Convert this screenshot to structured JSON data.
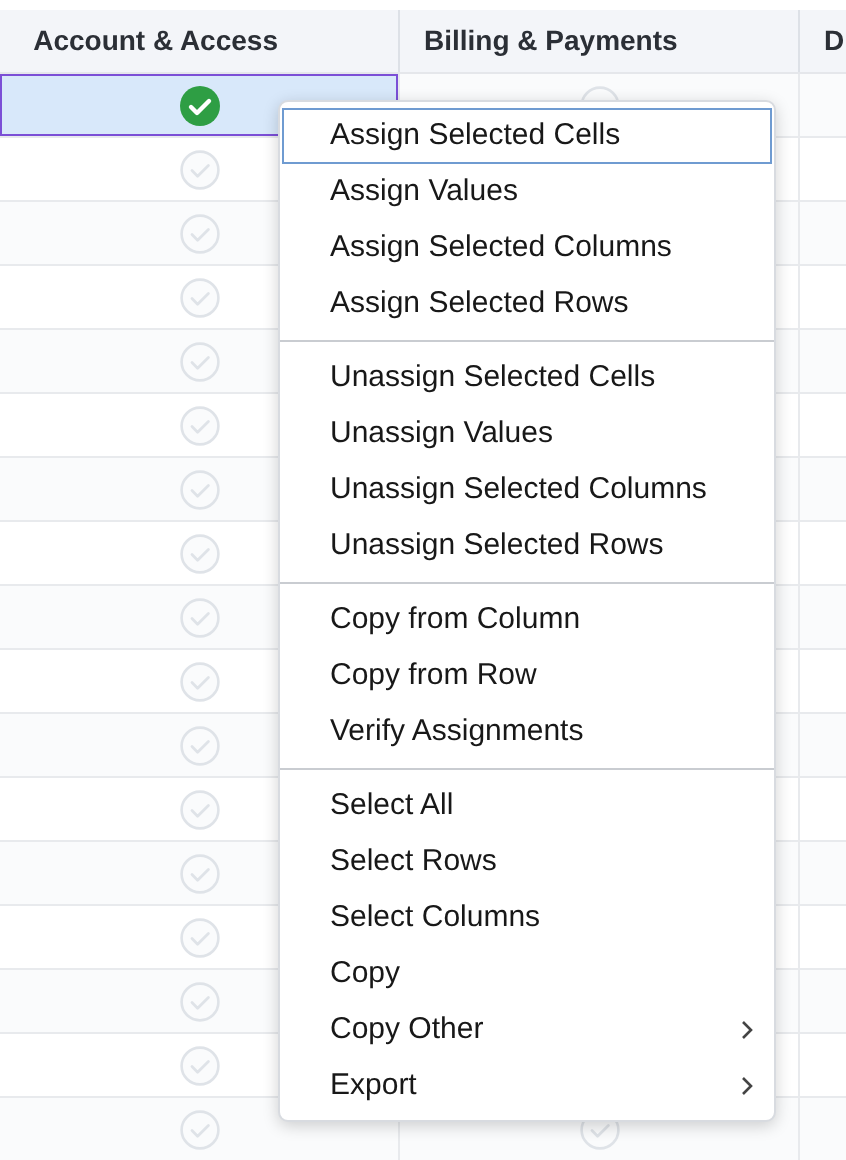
{
  "table": {
    "columns": [
      {
        "label": "Account & Access"
      },
      {
        "label": "Billing & Payments"
      },
      {
        "label": "D"
      }
    ],
    "rows": [
      {
        "selected": true,
        "cells": [
          {
            "checked": true
          },
          {
            "checked": false
          },
          null
        ]
      },
      {
        "selected": false,
        "cells": [
          {
            "checked": false
          },
          null,
          null
        ]
      },
      {
        "selected": false,
        "cells": [
          {
            "checked": false
          },
          null,
          null
        ]
      },
      {
        "selected": false,
        "cells": [
          {
            "checked": false
          },
          null,
          null
        ]
      },
      {
        "selected": false,
        "cells": [
          {
            "checked": false
          },
          null,
          null
        ]
      },
      {
        "selected": false,
        "cells": [
          {
            "checked": false
          },
          null,
          null
        ]
      },
      {
        "selected": false,
        "cells": [
          {
            "checked": false
          },
          null,
          null
        ]
      },
      {
        "selected": false,
        "cells": [
          {
            "checked": false
          },
          null,
          null
        ]
      },
      {
        "selected": false,
        "cells": [
          {
            "checked": false
          },
          null,
          null
        ]
      },
      {
        "selected": false,
        "cells": [
          {
            "checked": false
          },
          null,
          null
        ]
      },
      {
        "selected": false,
        "cells": [
          {
            "checked": false
          },
          null,
          null
        ]
      },
      {
        "selected": false,
        "cells": [
          {
            "checked": false
          },
          null,
          null
        ]
      },
      {
        "selected": false,
        "cells": [
          {
            "checked": false
          },
          null,
          null
        ]
      },
      {
        "selected": false,
        "cells": [
          {
            "checked": false
          },
          null,
          null
        ]
      },
      {
        "selected": false,
        "cells": [
          {
            "checked": false
          },
          null,
          null
        ]
      },
      {
        "selected": false,
        "cells": [
          {
            "checked": false
          },
          null,
          null
        ]
      },
      {
        "selected": false,
        "cells": [
          {
            "checked": false
          },
          {
            "checked": false
          },
          null
        ]
      }
    ]
  },
  "context_menu": {
    "groups": [
      [
        {
          "label": "Assign Selected Cells",
          "selected": true,
          "submenu": false
        },
        {
          "label": "Assign Values",
          "selected": false,
          "submenu": false
        },
        {
          "label": "Assign Selected Columns",
          "selected": false,
          "submenu": false
        },
        {
          "label": "Assign Selected Rows",
          "selected": false,
          "submenu": false
        }
      ],
      [
        {
          "label": "Unassign Selected Cells",
          "selected": false,
          "submenu": false
        },
        {
          "label": "Unassign Values",
          "selected": false,
          "submenu": false
        },
        {
          "label": "Unassign Selected Columns",
          "selected": false,
          "submenu": false
        },
        {
          "label": "Unassign Selected Rows",
          "selected": false,
          "submenu": false
        }
      ],
      [
        {
          "label": "Copy from Column",
          "selected": false,
          "submenu": false
        },
        {
          "label": "Copy from Row",
          "selected": false,
          "submenu": false
        },
        {
          "label": "Verify Assignments",
          "selected": false,
          "submenu": false
        }
      ],
      [
        {
          "label": "Select All",
          "selected": false,
          "submenu": false
        },
        {
          "label": "Select Rows",
          "selected": false,
          "submenu": false
        },
        {
          "label": "Select Columns",
          "selected": false,
          "submenu": false
        },
        {
          "label": "Copy",
          "selected": false,
          "submenu": false
        },
        {
          "label": "Copy Other",
          "selected": false,
          "submenu": true
        },
        {
          "label": "Export",
          "selected": false,
          "submenu": true
        }
      ]
    ]
  }
}
